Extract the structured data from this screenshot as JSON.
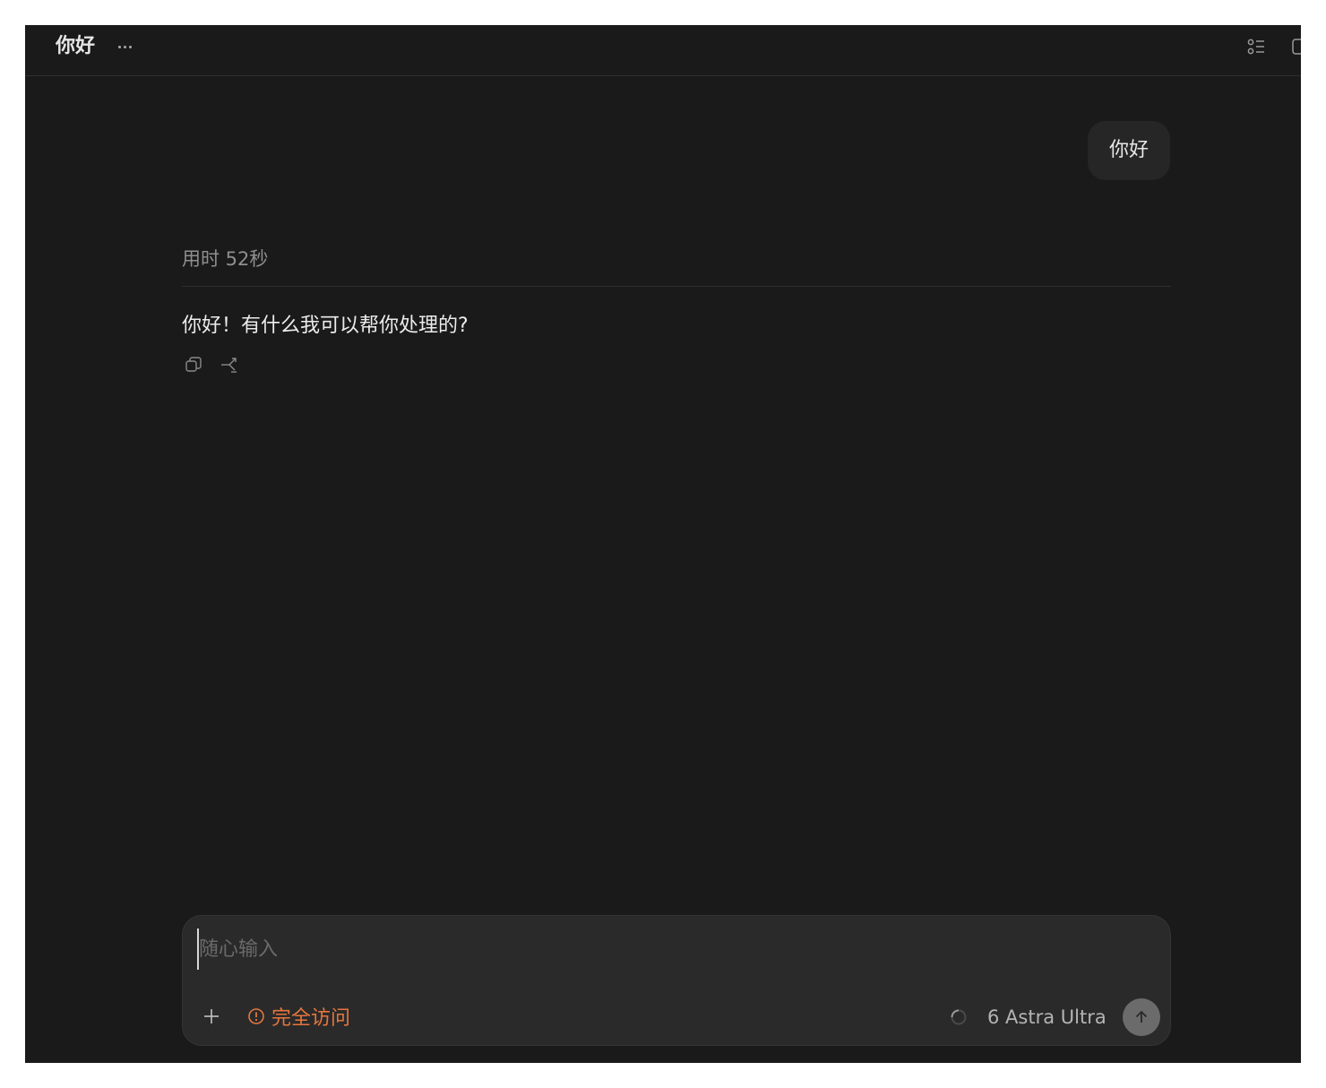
{
  "header": {
    "title": "你好",
    "more_icon": "more-horizontal-icon",
    "list_icon": "list-icon",
    "panel_icon": "panel-icon"
  },
  "conversation": {
    "user_message": "你好",
    "duration": "用时 52秒",
    "assistant_reply": "你好！有什么我可以帮你处理的?",
    "actions": [
      "copy-icon",
      "fork-icon"
    ]
  },
  "composer": {
    "placeholder": "随心输入",
    "value": "",
    "access_label": "完全访问",
    "model_label": "6 Astra Ultra",
    "accent_color": "#e5763e"
  }
}
